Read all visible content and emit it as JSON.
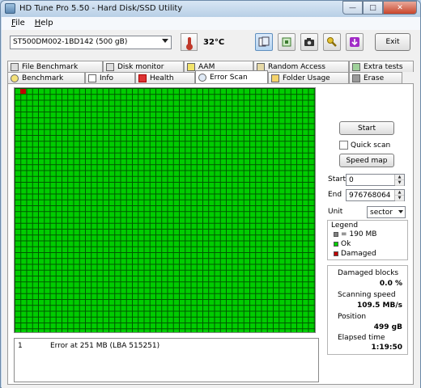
{
  "window": {
    "title": "HD Tune Pro 5.50 - Hard Disk/SSD Utility"
  },
  "menu": [
    "File",
    "Help"
  ],
  "toolbar": {
    "drive": "ST500DM002-1BD142 (500 gB)",
    "temperature": "32°C",
    "exit_label": "Exit"
  },
  "tabs_top": [
    "File Benchmark",
    "Disk monitor",
    "AAM",
    "Random Access",
    "Extra tests"
  ],
  "tabs_bottom": [
    "Benchmark",
    "Info",
    "Health",
    "Error Scan",
    "Folder Usage",
    "Erase"
  ],
  "active_tab": "Error Scan",
  "controls": {
    "start_label": "Start",
    "quick_scan_label": "Quick scan",
    "quick_scan_checked": false,
    "speed_map_label": "Speed map",
    "start_field_label": "Start",
    "start_value": "0",
    "end_field_label": "End",
    "end_value": "976768064",
    "unit_label": "Unit",
    "unit_value": "sector"
  },
  "legend": {
    "title": "Legend",
    "items": [
      {
        "label": "= 190 MB",
        "color": "#808080"
      },
      {
        "label": "Ok",
        "color": "#00cc00"
      },
      {
        "label": "Damaged",
        "color": "#c00000"
      }
    ]
  },
  "stats": {
    "damaged_blocks_label": "Damaged blocks",
    "damaged_blocks_value": "0.0 %",
    "scanning_speed_label": "Scanning speed",
    "scanning_speed_value": "109.5 MB/s",
    "position_label": "Position",
    "position_value": "499 gB",
    "elapsed_time_label": "Elapsed time",
    "elapsed_time_value": "1:19:50"
  },
  "error_log": [
    {
      "index": "1",
      "message": "Error at 251 MB (LBA 515251)"
    }
  ],
  "colors": {
    "ok": "#00cc00",
    "damaged": "#c00000",
    "grid_line": "#005500"
  }
}
